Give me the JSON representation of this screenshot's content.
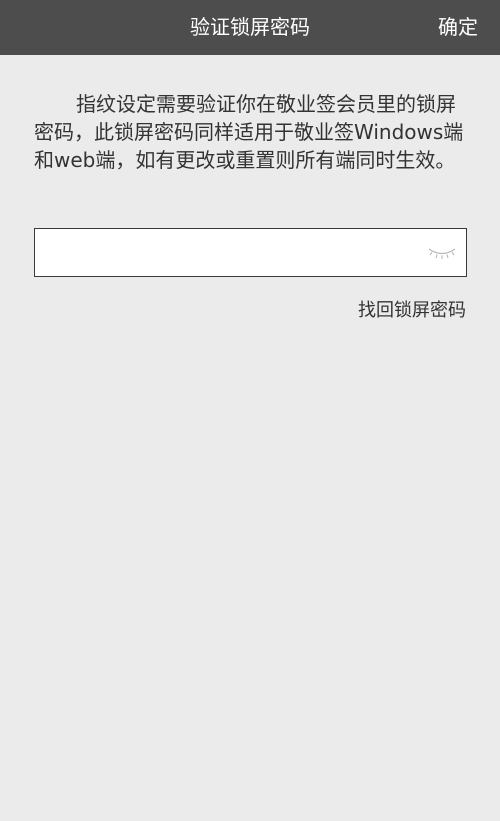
{
  "header": {
    "title": "验证锁屏密码",
    "confirm_label": "确定"
  },
  "description": "指纹设定需要验证你在敬业签会员里的锁屏密码，此锁屏密码同样适用于敬业签Windows端和web端，如有更改或重置则所有端同时生效。",
  "password_field": {
    "value": "",
    "placeholder": "",
    "toggle_icon": "eye-closed-icon"
  },
  "forgot_password_label": "找回锁屏密码",
  "colors": {
    "header_background": "#4d4d4d",
    "page_background": "#ebebeb",
    "text": "#333333"
  }
}
